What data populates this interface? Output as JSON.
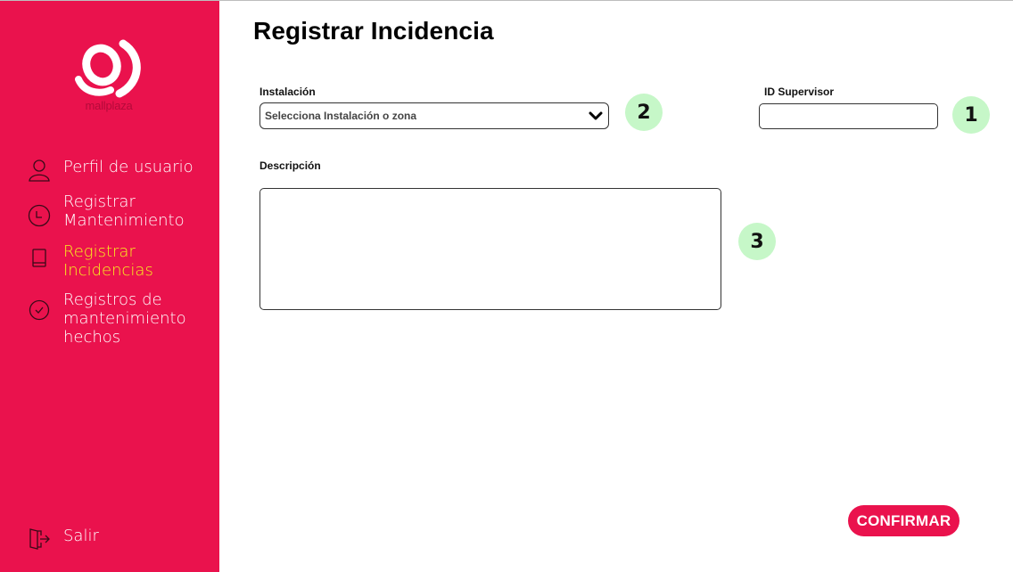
{
  "brand": {
    "logo_text": "mallplaza",
    "primary_color": "#ea124d",
    "active_color": "#f6f11e",
    "badge_color": "#c6f7c8"
  },
  "sidebar": {
    "items": [
      {
        "label": "Perfil de usuario",
        "icon": "user-icon",
        "active": false
      },
      {
        "label": "Registrar\nMantenimiento",
        "icon": "clock-icon",
        "active": false
      },
      {
        "label": "Registrar\nIncidencias",
        "icon": "book-icon",
        "active": true
      },
      {
        "label": "Registros de\nmantenimiento\nhechos",
        "icon": "check-circle-icon",
        "active": false
      }
    ],
    "logout": {
      "label": "Salir",
      "icon": "logout-icon"
    }
  },
  "main": {
    "title": "Registrar Incidencia",
    "instalacion": {
      "label": "Instalación",
      "selected": "Selecciona Instalación o zona",
      "icon": "chevron-down-icon"
    },
    "supervisor": {
      "label": "ID Supervisor",
      "value": ""
    },
    "descripcion": {
      "label": "Descripción",
      "value": ""
    },
    "badges": [
      "1",
      "2",
      "3"
    ],
    "confirm_label": "CONFIRMAR"
  }
}
